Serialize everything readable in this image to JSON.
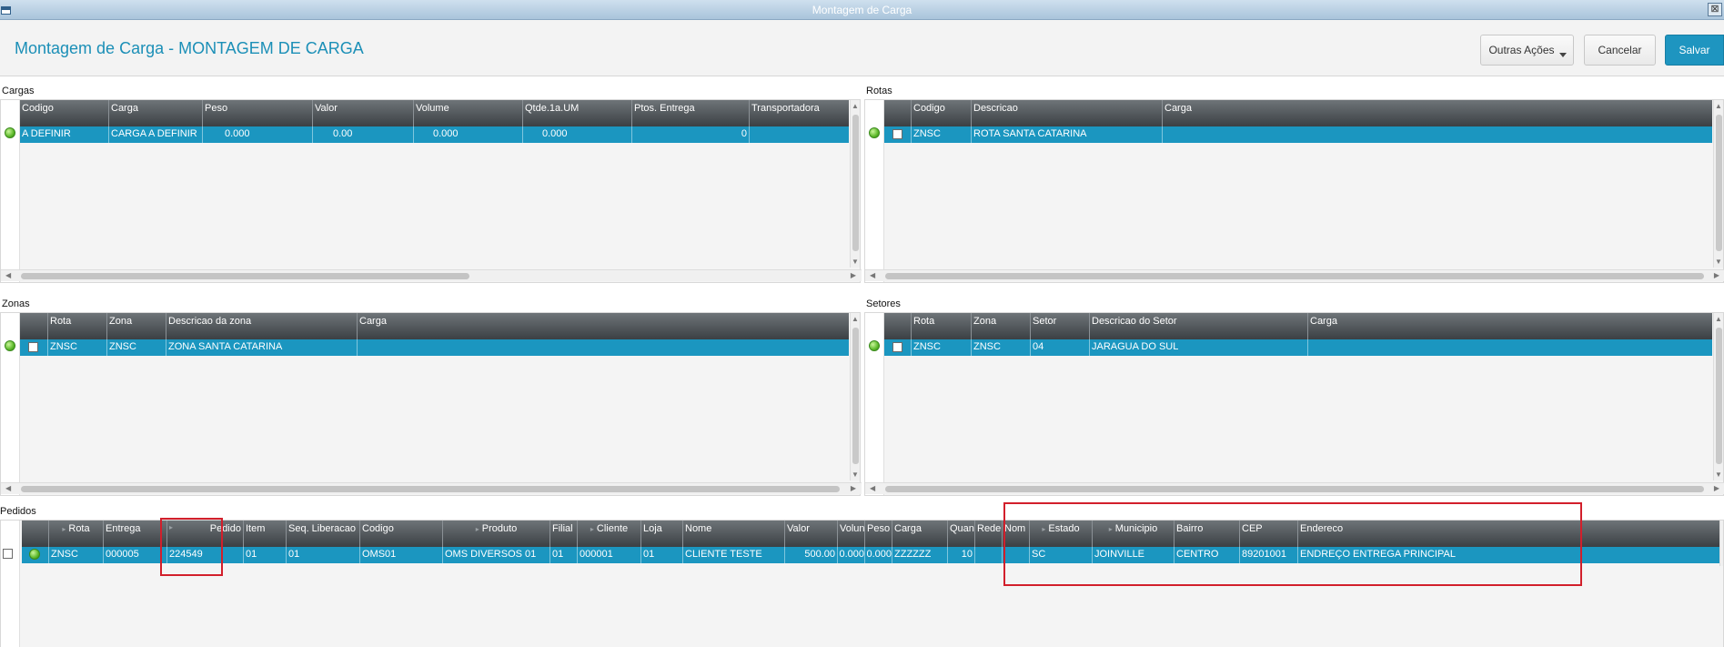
{
  "window": {
    "title": "Montagem de Carga",
    "close_glyph": "⊠"
  },
  "header": {
    "title": "Montagem de Carga - MONTAGEM DE CARGA",
    "other_actions_label": "Outras Ações",
    "cancel_label": "Cancelar",
    "save_label": "Salvar"
  },
  "colors": {
    "accent": "#1b96c0",
    "title": "#1b8fb7",
    "highlight": "#d21f2b",
    "header_bg": "#3b4044"
  },
  "cargas": {
    "label": "Cargas",
    "columns": [
      "Codigo",
      "Carga",
      "Peso",
      "Valor",
      "Volume",
      "Qtde.1a.UM",
      "Ptos. Entrega",
      "Transportadora"
    ],
    "row": [
      "A DEFINIR",
      "CARGA A DEFINIR",
      "0.000",
      "0.00",
      "0.000",
      "0.000",
      "0",
      ""
    ]
  },
  "rotas": {
    "label": "Rotas",
    "columns": [
      "Codigo",
      "Descricao",
      "Carga"
    ],
    "row": [
      "ZNSC",
      "ROTA SANTA CATARINA",
      ""
    ]
  },
  "zonas": {
    "label": "Zonas",
    "columns": [
      "Rota",
      "Zona",
      "Descricao da zona",
      "Carga"
    ],
    "row": [
      "ZNSC",
      "ZNSC",
      "ZONA SANTA CATARINA",
      ""
    ]
  },
  "setores": {
    "label": "Setores",
    "columns": [
      "Rota",
      "Zona",
      "Setor",
      "Descricao do Setor",
      "Carga"
    ],
    "row": [
      "ZNSC",
      "ZNSC",
      "04",
      "JARAGUA DO SUL",
      ""
    ]
  },
  "pedidos": {
    "label": "Pedidos",
    "columns": [
      "Rota",
      "Entrega",
      "Pedido",
      "Item",
      "Seq. Liberacao",
      "Codigo",
      "Produto",
      "Filial",
      "Cliente",
      "Loja",
      "Nome",
      "Valor",
      "Volun",
      "Peso",
      "Carga",
      "Quan",
      "Rede",
      "Nom",
      "Estado",
      "Municipio",
      "Bairro",
      "CEP",
      "Endereco"
    ],
    "row": [
      "ZNSC",
      "000005",
      "224549",
      "01",
      "01",
      "OMS01",
      "OMS DIVERSOS  01",
      "01",
      "000001",
      "01",
      "CLIENTE TESTE",
      "500.00",
      "0.000",
      "0.000",
      "ZZZZZZ",
      "10",
      "",
      "",
      "SC",
      "JOINVILLE",
      "CENTRO",
      "89201001",
      "ENDREÇO ENTREGA PRINCIPAL"
    ]
  }
}
